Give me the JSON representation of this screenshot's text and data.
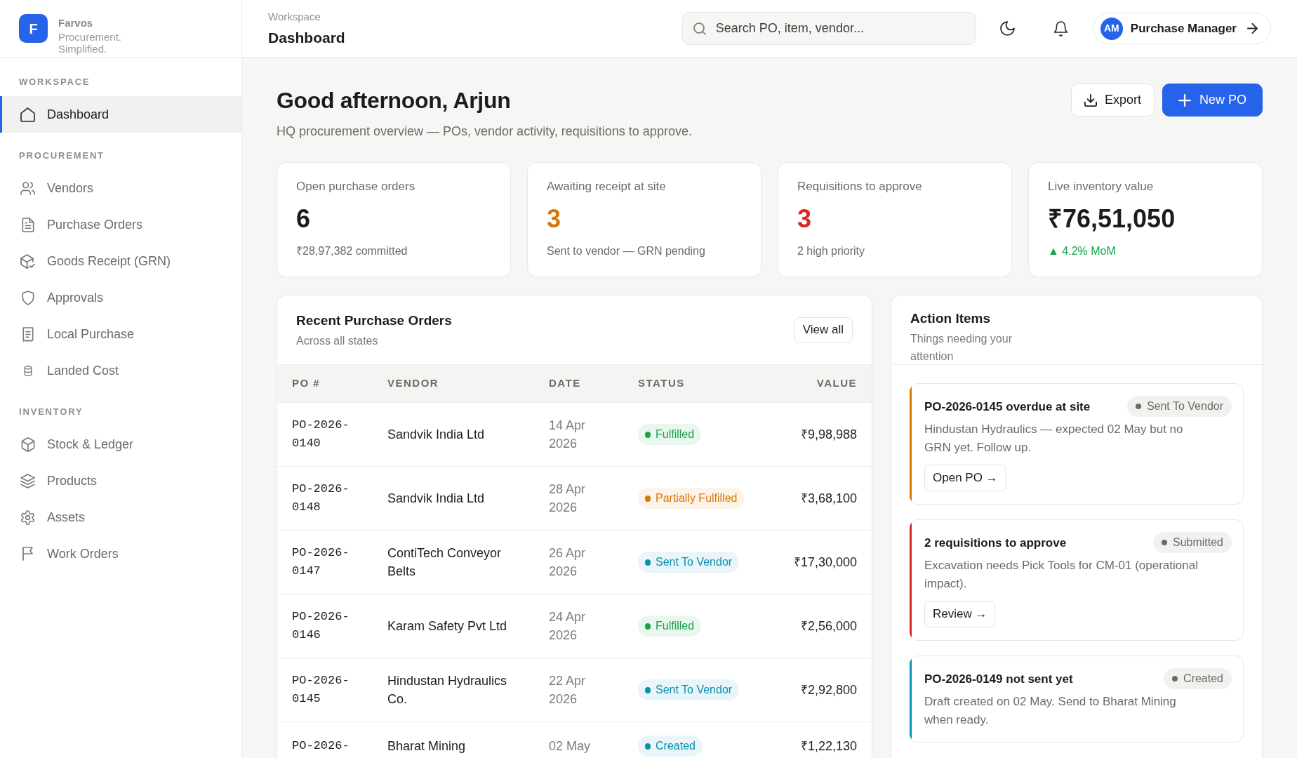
{
  "sidebar": {
    "brand": {
      "logo_letter": "F",
      "name": "Farvos",
      "tagline": "Procurement. Simplified."
    },
    "sections": [
      {
        "heading": "WORKSPACE",
        "items": [
          {
            "label": "Dashboard",
            "selected": true
          }
        ]
      },
      {
        "heading": "PROCUREMENT",
        "items": [
          {
            "label": "Vendors",
            "selected": false
          },
          {
            "label": "Purchase Orders",
            "selected": false
          },
          {
            "label": "Goods Receipt (GRN)",
            "selected": false
          },
          {
            "label": "Approvals",
            "selected": false
          },
          {
            "label": "Local Purchase",
            "selected": false
          },
          {
            "label": "Landed Cost",
            "selected": false
          }
        ]
      },
      {
        "heading": "INVENTORY",
        "items": [
          {
            "label": "Stock & Ledger",
            "selected": false
          },
          {
            "label": "Products",
            "selected": false
          },
          {
            "label": "Assets",
            "selected": false
          },
          {
            "label": "Work Orders",
            "selected": false
          }
        ]
      }
    ]
  },
  "header": {
    "breadcrumb": "Workspace",
    "title": "Dashboard",
    "search": {
      "placeholder": "Search PO, item, vendor..."
    },
    "user": {
      "initials": "AM",
      "name": "Purchase Manager"
    }
  },
  "overview": {
    "greeting": "Good afternoon, Arjun",
    "subtitle": "HQ procurement overview — POs, vendor activity, requisitions to approve.",
    "buttons": [
      {
        "label": "Export",
        "kind": "secondary"
      },
      {
        "label": "New PO",
        "kind": "primary"
      }
    ]
  },
  "stats": [
    {
      "label": "Open purchase orders",
      "value": "6",
      "color": "#1c1c1a",
      "note": "₹28,97,382 committed",
      "positive": false
    },
    {
      "label": "Awaiting receipt at site",
      "value": "3",
      "color": "#d97706",
      "note": "Sent to vendor — GRN pending",
      "positive": false
    },
    {
      "label": "Requisitions to approve",
      "value": "3",
      "color": "#dc2626",
      "note": "2 high priority",
      "positive": false
    },
    {
      "label": "Live inventory value",
      "value": "₹76,51,050",
      "color": "#1c1c1a",
      "note": "▲ 4.2% MoM",
      "positive": true
    }
  ],
  "recent_orders": {
    "title": "Recent Purchase Orders",
    "subtitle": "Across all states",
    "view_all": "View all",
    "columns": [
      "PO #",
      "VENDOR",
      "DATE",
      "STATUS",
      "VALUE"
    ],
    "rows": [
      {
        "po": "PO-2026-0140",
        "vendor": "Sandvik India Ltd",
        "date": "14 Apr 2026",
        "status": {
          "label": "Fulfilled",
          "color": "#16a34a"
        },
        "value": "₹9,98,988"
      },
      {
        "po": "PO-2026-0148",
        "vendor": "Sandvik India Ltd",
        "date": "28 Apr 2026",
        "status": {
          "label": "Partially Fulfilled",
          "color": "#d97706"
        },
        "value": "₹3,68,100"
      },
      {
        "po": "PO-2026-0147",
        "vendor": "ContiTech Conveyor Belts",
        "date": "26 Apr 2026",
        "status": {
          "label": "Sent To Vendor",
          "color": "#0891b2"
        },
        "value": "₹17,30,000"
      },
      {
        "po": "PO-2026-0146",
        "vendor": "Karam Safety Pvt Ltd",
        "date": "24 Apr 2026",
        "status": {
          "label": "Fulfilled",
          "color": "#16a34a"
        },
        "value": "₹2,56,000"
      },
      {
        "po": "PO-2026-0145",
        "vendor": "Hindustan Hydraulics Co.",
        "date": "22 Apr 2026",
        "status": {
          "label": "Sent To Vendor",
          "color": "#0891b2"
        },
        "value": "₹2,92,800"
      },
      {
        "po": "PO-2026-",
        "vendor": "Bharat Mining",
        "date": "02 May",
        "status": {
          "label": "Created",
          "color": "#0891b2"
        },
        "value": "₹1,22,130"
      }
    ]
  },
  "action_items": {
    "title": "Action Items",
    "subtitle": "Things needing your attention",
    "items": [
      {
        "title": "PO-2026-0145 overdue at site",
        "status": "Sent To Vendor",
        "description": "Hindustan Hydraulics — expected 02 May but no GRN yet. Follow up.",
        "action": "Open PO →",
        "color": "#d97706"
      },
      {
        "title": "2 requisitions to approve",
        "status": "Submitted",
        "description": "Excavation needs Pick Tools for CM-01 (operational impact).",
        "action": "Review →",
        "color": "#dc2626"
      },
      {
        "title": "PO-2026-0149 not sent yet",
        "status": "Created",
        "description": "Draft created on 02 May. Send to Bharat Mining when ready.",
        "color": "#0891b2"
      }
    ]
  }
}
